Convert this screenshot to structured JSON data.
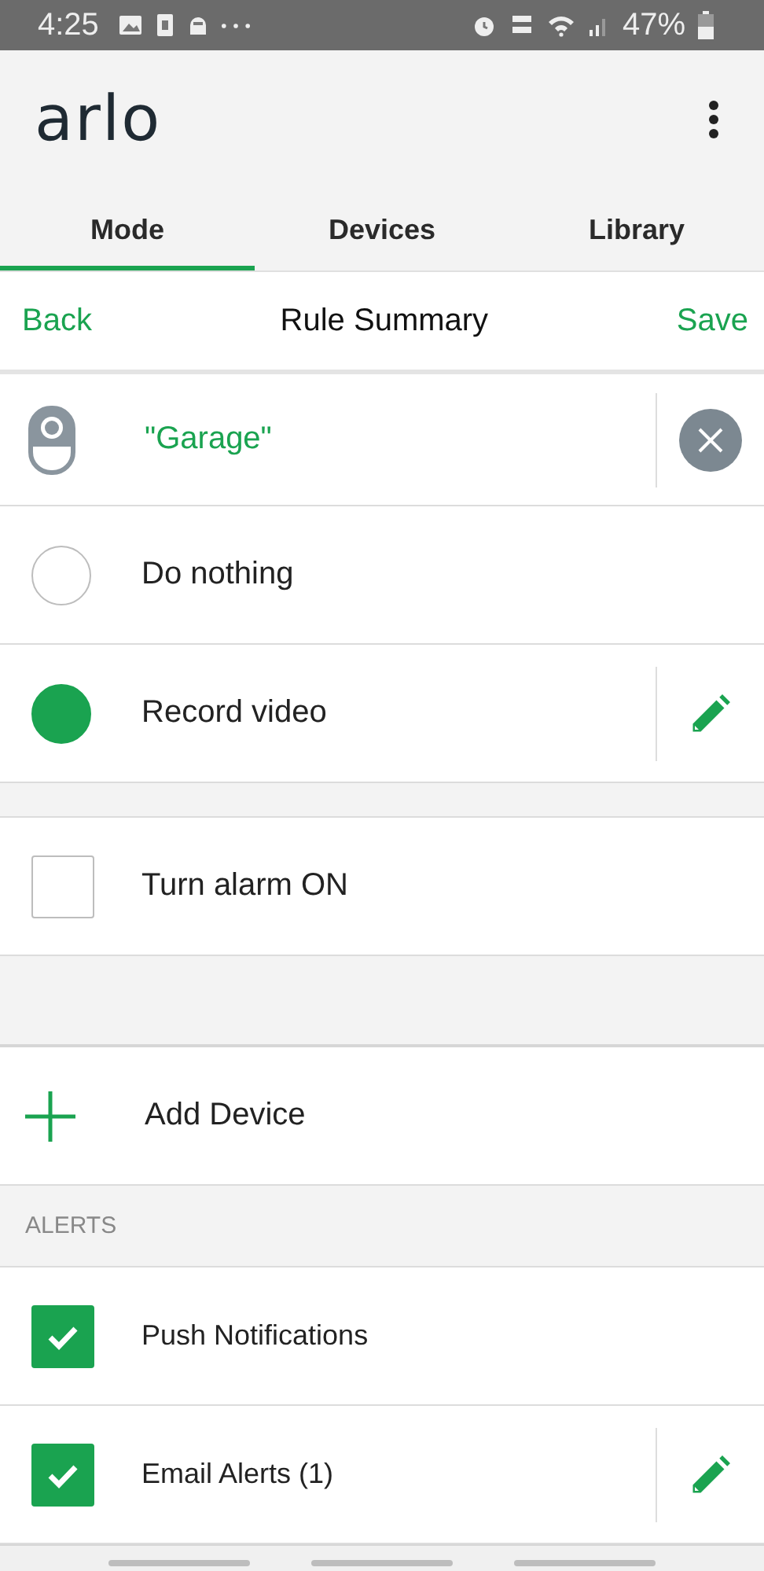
{
  "status_bar": {
    "time": "4:25",
    "battery": "47%"
  },
  "app_bar": {
    "logo": "arlo"
  },
  "tabs": [
    {
      "label": "Mode",
      "selected": true
    },
    {
      "label": "Devices",
      "selected": false
    },
    {
      "label": "Library",
      "selected": false
    }
  ],
  "nav": {
    "back": "Back",
    "title": "Rule Summary",
    "save": "Save"
  },
  "device": {
    "name": "\"Garage\""
  },
  "actions": [
    {
      "kind": "radio",
      "label": "Do nothing",
      "selected": false,
      "editable": false
    },
    {
      "kind": "radio",
      "label": "Record video",
      "selected": true,
      "editable": true
    },
    {
      "kind": "checkbox",
      "label": "Turn alarm ON",
      "checked": false,
      "editable": false
    }
  ],
  "add_device": {
    "label": "Add Device"
  },
  "alerts": {
    "header": "ALERTS",
    "items": [
      {
        "label": "Push Notifications",
        "checked": true,
        "editable": false
      },
      {
        "label": "Email Alerts (1)",
        "checked": true,
        "editable": true
      }
    ]
  }
}
